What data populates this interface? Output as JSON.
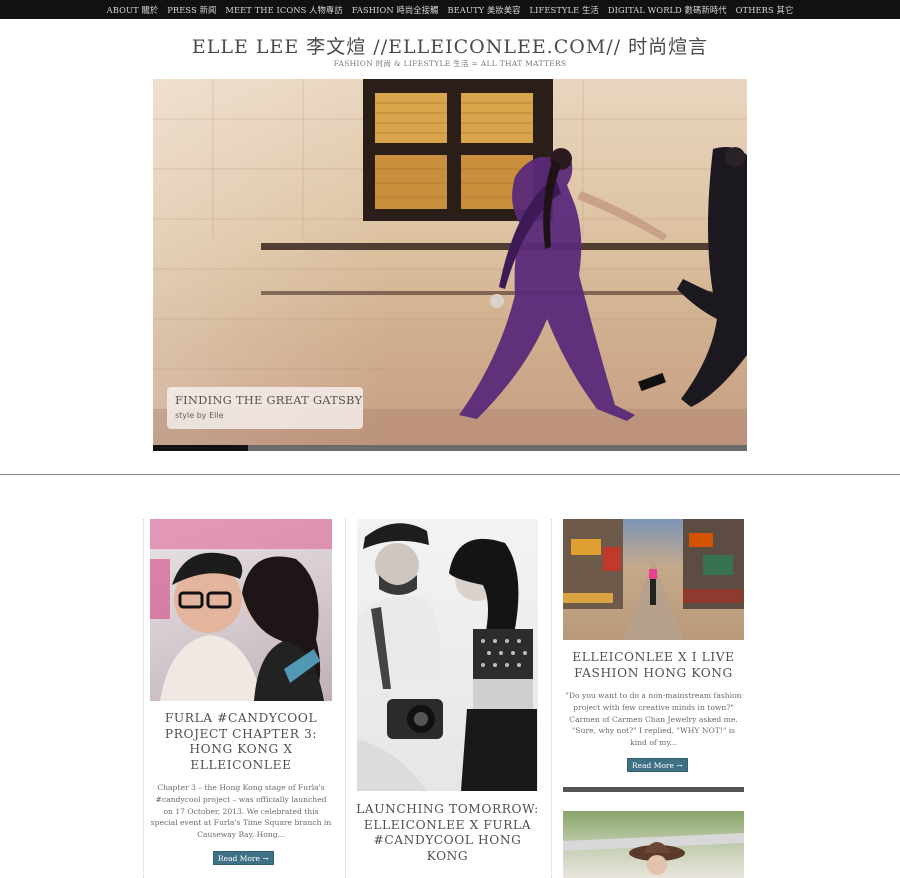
{
  "nav": {
    "items": [
      {
        "label": "ABOUT 關於"
      },
      {
        "label": "PRESS 新闻"
      },
      {
        "label": "MEET THE ICONS 人物專訪"
      },
      {
        "label": "FASHION 時尚全接觸"
      },
      {
        "label": "BEAUTY 美妝美容"
      },
      {
        "label": "LIFESTYLE 生活"
      },
      {
        "label": "DIGITAL WORLD 數碼新時代"
      },
      {
        "label": "OTHERS 其它"
      }
    ]
  },
  "header": {
    "title": "ELLE LEE 李文煊 //ELLEICONLEE.COM// 时尚煊言",
    "tagline": "FASHION 时尚 & LIFESTYLE 生活 = ALL THAT MATTERS"
  },
  "slider": {
    "caption_title": "FINDING THE GREAT GATSBY",
    "caption_sub": "style by Elle",
    "progress": 0.16
  },
  "posts": [
    {
      "title": "FURLA #CANDYCOOL PROJECT CHAPTER 3: HONG KONG X ELLEICONLEE",
      "excerpt": "Chapter 3 – the Hong Kong stage of Furla's #candycool project – was officially launched on 17 October, 2013. We celebrated this special event at Furla's Time Square branch in Causeway Bay, Hong...",
      "read_more": "Read More →"
    },
    {
      "title": "LAUNCHING TOMORROW: ELLEICONLEE X FURLA #CANDYCOOL HONG KONG",
      "excerpt": "",
      "read_more": ""
    },
    {
      "title": "ELLEICONLEE X I LIVE FASHION HONG KONG",
      "excerpt": "\"Do you want to do a non-mainstream fashion project with few creative minds in town?\" Carmen of Carmen Chan Jewelry asked me. \"Sure, why not?\" I replied. \"WHY NOT!\" is kind of my...",
      "read_more": "Read More →"
    }
  ],
  "colors": {
    "nav_bg": "#111111",
    "read_more_bg": "#3f7186",
    "text": "#4f4f4f"
  }
}
